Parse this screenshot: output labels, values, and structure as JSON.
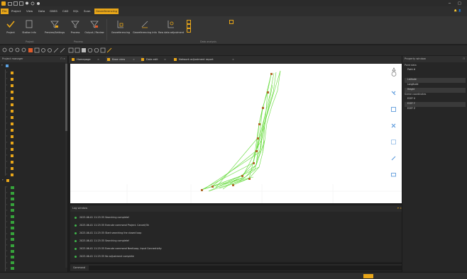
{
  "titlebar": {
    "title": "",
    "title_brief": "",
    "minimize": "─",
    "maximize": "□"
  },
  "menu": {
    "file": "File",
    "items": [
      "Project",
      "View",
      "Data",
      "GNSS",
      "CAD",
      "SQL",
      "Scan",
      "Georeferencing"
    ]
  },
  "user": {
    "label": "",
    "bell": "🔔",
    "person": "👤"
  },
  "ribbon": {
    "buttons": [
      "Project",
      "Station info",
      "Preview/Settings",
      "Process",
      "Output / Review",
      "Georeferencing",
      "Georeferencing Info",
      "Raw data adjustment"
    ],
    "small_options": [
      "",
      "",
      "",
      ""
    ],
    "groups": [
      "Project",
      "Process",
      "Data analysis"
    ]
  },
  "left_panel": {
    "title": "Project manager",
    "root_label": "",
    "scans": [
      "",
      "",
      "",
      "",
      "",
      "",
      "",
      "",
      "",
      "",
      "",
      "",
      "",
      "",
      "",
      "",
      ""
    ],
    "group_label": "",
    "images": [
      "",
      "",
      "",
      "",
      "",
      "",
      "",
      "",
      "",
      "",
      "",
      "",
      "",
      "",
      ""
    ]
  },
  "tabs": [
    "Homepage",
    "Base view",
    "Data edit",
    "Network adjustment report"
  ],
  "viewport": {
    "labels": [
      "",
      "",
      "",
      "",
      "",
      "",
      "",
      "",
      "",
      "",
      ""
    ],
    "ticks": [
      "",
      "",
      "",
      "",
      "",
      ""
    ],
    "marker_labels": [
      "",
      "",
      "",
      "",
      "",
      "",
      "",
      ""
    ],
    "error_label": ""
  },
  "log": {
    "title": "Log window",
    "lines": [
      "2023-06-01 11:25:35  Searching complete!",
      "2023-06-01 11:25:35  Execute command Project. Cancel/Ok",
      "2023-06-01 11:25:35  Start searching the closed loop",
      "2023-06-01 11:25:35  Searching complete!",
      "2023-06-01 11:25:35  Execute command NextLoop, Input Connectivity",
      "2023-06-01 11:25:35  No adjustment complete"
    ]
  },
  "command": {
    "label": "Command",
    "placeholder": ""
  },
  "properties": {
    "title": "Property window",
    "section1": {
      "title": "Point data",
      "rows": [
        {
          "key": "Point #",
          "value": ""
        }
      ]
    },
    "section2": {
      "title": "",
      "rows": [
        {
          "key": "Latitude",
          "value": ""
        },
        {
          "key": "Longitude",
          "value": ""
        },
        {
          "key": "Height",
          "value": ""
        }
      ]
    },
    "section3": {
      "title": "Scene coordinates",
      "rows": [
        {
          "key": "ECEF X",
          "value": ""
        },
        {
          "key": "ECEF Y",
          "value": ""
        },
        {
          "key": "ECEF Z",
          "value": ""
        }
      ]
    }
  },
  "status": {
    "left": "",
    "right": ""
  },
  "colors": {
    "accent": "#e8a619",
    "network": "#49d417",
    "dark": "#262626"
  }
}
